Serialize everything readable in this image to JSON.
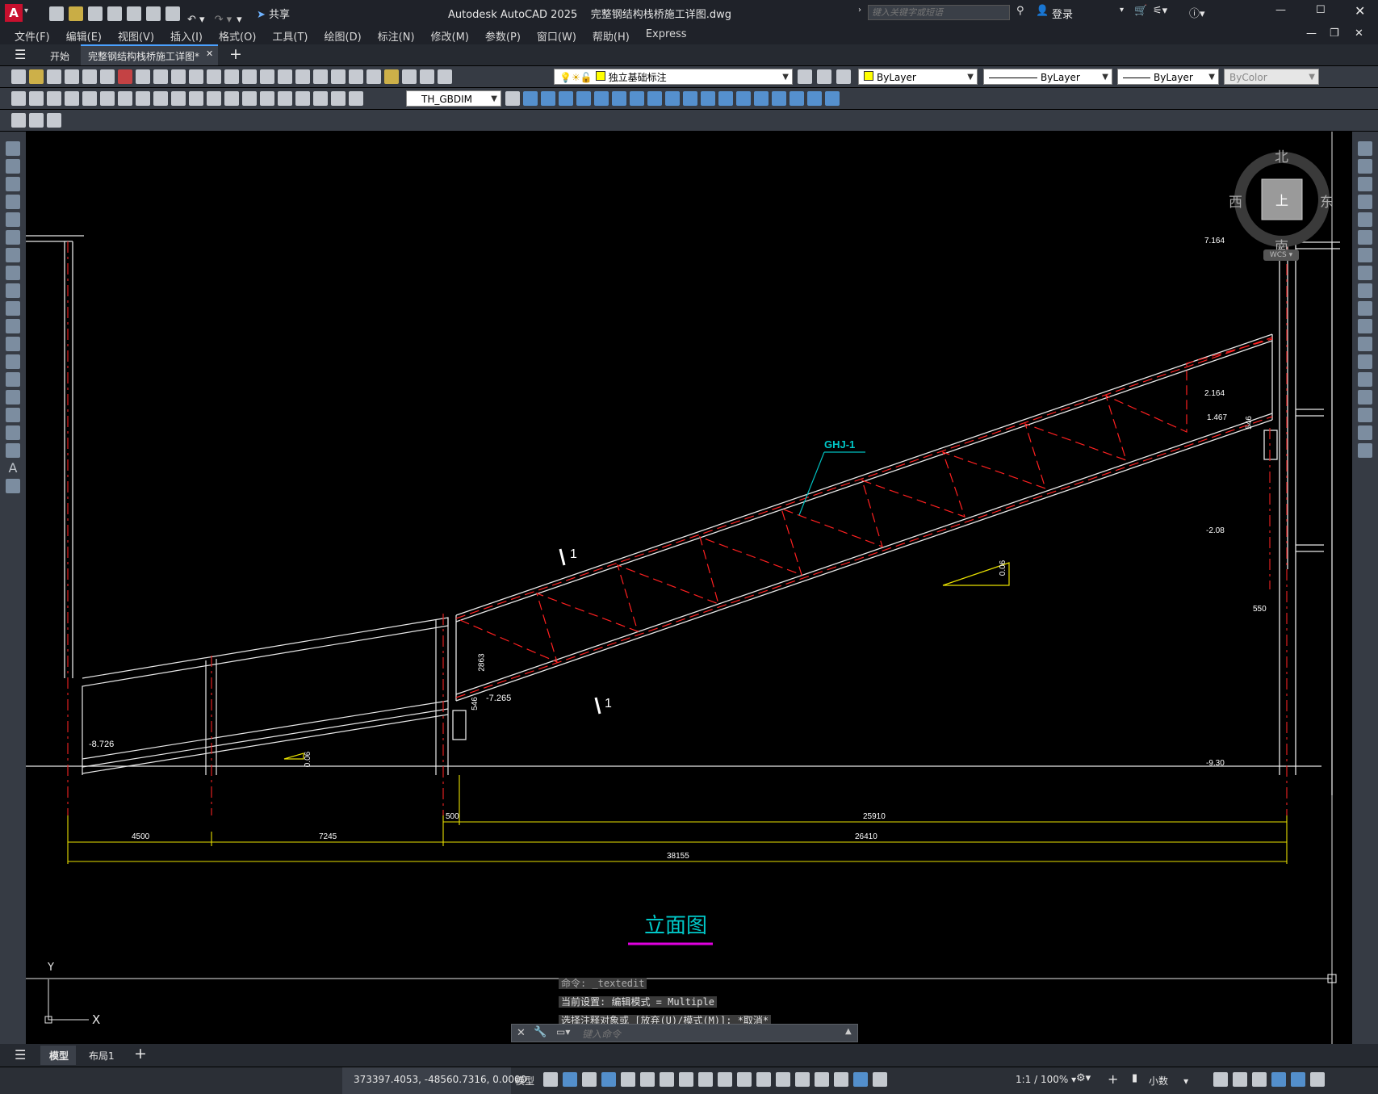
{
  "app": {
    "title": "Autodesk AutoCAD 2025",
    "document": "完整钢结构栈桥施工详图.dwg",
    "search_placeholder": "键入关键字或短语",
    "login": "登录",
    "share": "共享"
  },
  "menu": [
    "文件(F)",
    "编辑(E)",
    "视图(V)",
    "插入(I)",
    "格式(O)",
    "工具(T)",
    "绘图(D)",
    "标注(N)",
    "修改(M)",
    "参数(P)",
    "窗口(W)",
    "帮助(H)",
    "Express"
  ],
  "tabs": {
    "start": "开始",
    "active": "完整钢结构栈桥施工详图*"
  },
  "toolbar": {
    "layer": "独立基础标注",
    "color": "ByLayer",
    "linetype": "ByLayer",
    "lineweight": "ByLayer",
    "plotstyle": "ByColor",
    "dimstyle": "TH_GBDIM"
  },
  "viewcube": {
    "north": "北",
    "south": "南",
    "east": "东",
    "west": "西",
    "top": "上",
    "wcs": "WCS"
  },
  "drawing": {
    "label_ghj": "GHJ-1",
    "section_mark": "1",
    "title": "立面图",
    "slope": "0.06",
    "elev_left": "-8.726",
    "elev_mid": "-7.265",
    "elev_right1": "7.164",
    "elev_right2": "2.164",
    "elev_right3": "-2.08",
    "elev_right4": "-9.30",
    "elev_top": "1.467",
    "dim_2863": "2863",
    "dim_546": "546",
    "dim_550": "550",
    "dims_row1": [
      "500",
      "25910"
    ],
    "dims_row2": [
      "4500",
      "7245",
      "26410"
    ],
    "dims_row3": [
      "38155"
    ]
  },
  "command": {
    "line1": "命令: _textedit",
    "line2": "当前设置: 编辑模式 = Multiple",
    "line3": "选择注释对象或 [放弃(U)/模式(M)]: *取消*",
    "placeholder": "键入命令"
  },
  "ucs": {
    "x": "X",
    "y": "Y"
  },
  "layout_tabs": {
    "model": "模型",
    "layout1": "布局1"
  },
  "status": {
    "coords": "373397.4053, -48560.7316, 0.0000",
    "space": "模型",
    "scale": "1:1 / 100%",
    "units": "小数"
  }
}
